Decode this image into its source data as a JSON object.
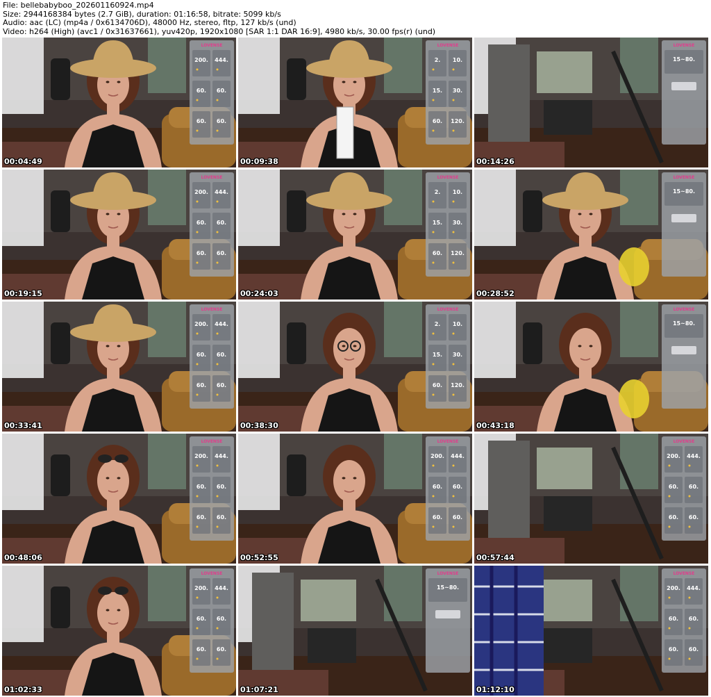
{
  "info": {
    "file_line": "File: bellebabyboo_202601160924.mp4",
    "size_line": "Size: 2944168384 bytes (2.7 GiB), duration: 01:16:58, bitrate: 5099 kb/s",
    "audio_line": "Audio: aac (LC) (mp4a / 0x6134706D), 48000 Hz, stereo, fltp, 127 kb/s (und)",
    "video_line": "Video: h264 (High) (avc1 / 0x31637661), yuv420p, 1920x1080 [SAR 1:1 DAR 16:9], 4980 kb/s, 30.00 fps(r) (und)"
  },
  "thumbnails": [
    {
      "time": "00:04:49",
      "scene": "hat",
      "panel": "A"
    },
    {
      "time": "00:09:38",
      "scene": "hat-card",
      "panel": "B"
    },
    {
      "time": "00:14:26",
      "scene": "kitchen",
      "panel": "C"
    },
    {
      "time": "00:19:15",
      "scene": "hat",
      "panel": "A"
    },
    {
      "time": "00:24:03",
      "scene": "hat",
      "panel": "B"
    },
    {
      "time": "00:28:52",
      "scene": "hat-drink",
      "panel": "C"
    },
    {
      "time": "00:33:41",
      "scene": "hat-hand",
      "panel": "A"
    },
    {
      "time": "00:38:30",
      "scene": "glasses",
      "panel": "B"
    },
    {
      "time": "00:43:18",
      "scene": "drinking",
      "panel": "C"
    },
    {
      "time": "00:48:06",
      "scene": "sunglasses-head",
      "panel": "A"
    },
    {
      "time": "00:52:55",
      "scene": "plain",
      "panel": "A"
    },
    {
      "time": "00:57:44",
      "scene": "room",
      "panel": "A"
    },
    {
      "time": "01:02:33",
      "scene": "sunglasses-chin",
      "panel": "A"
    },
    {
      "time": "01:07:21",
      "scene": "empty-room",
      "panel": "C"
    },
    {
      "time": "01:12:10",
      "scene": "skirt",
      "panel": "A"
    }
  ],
  "panels": {
    "A": {
      "header": "LOVENSE",
      "values": [
        "200.",
        "444.",
        "60.",
        "60.",
        "60.",
        "60."
      ]
    },
    "B": {
      "header": "LOVENSE",
      "values": [
        "2.",
        "10.",
        "15.",
        "30.",
        "60.",
        "120."
      ]
    },
    "C": {
      "header": "LOVENSE",
      "values": [
        "15~80."
      ]
    }
  },
  "colors": {
    "timestamp": "#ffffff",
    "panel_bg": "#9ea2a8",
    "panel_accent": "#e23c8c",
    "floor": "#3a2418",
    "dress": "#151515",
    "hat": "#c9a466",
    "sofa": "#9a6a2a",
    "skin": "#d9a58c",
    "hair": "#5a2e1c"
  }
}
